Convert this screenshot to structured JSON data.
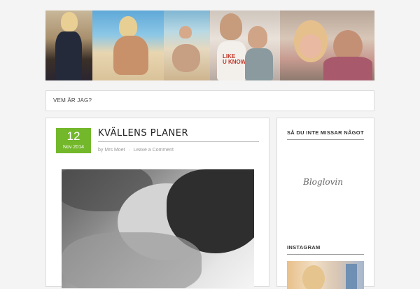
{
  "header": {
    "banner_photos": [
      "photo-woman-dress",
      "photo-woman-beach",
      "photo-kids-beach",
      "photo-two-girls",
      "photo-couple-selfie"
    ],
    "shirt_text": "LIKE\nU KNOW"
  },
  "nav": {
    "items": [
      {
        "label": "VEM ÄR JAG?"
      }
    ]
  },
  "post": {
    "date_day": "12",
    "date_month": "Nov 2014",
    "title": "KVÄLLENS PLANER",
    "meta_by": "by",
    "meta_author": "Mrs Moet",
    "meta_sep": "·",
    "meta_comment": "Leave a Comment",
    "image": "bw-photo-child-sleeping"
  },
  "sidebar": {
    "widget1_title": "SÅ DU INTE MISSAR NÅGOT",
    "bloglovin_label": "Bloglovin",
    "widget2_title": "INSTAGRAM",
    "instagram_image": "instagram-photo"
  },
  "colors": {
    "accent_green": "#72b82a",
    "background": "#f4f4f4",
    "card_border": "#dcdcdc"
  }
}
